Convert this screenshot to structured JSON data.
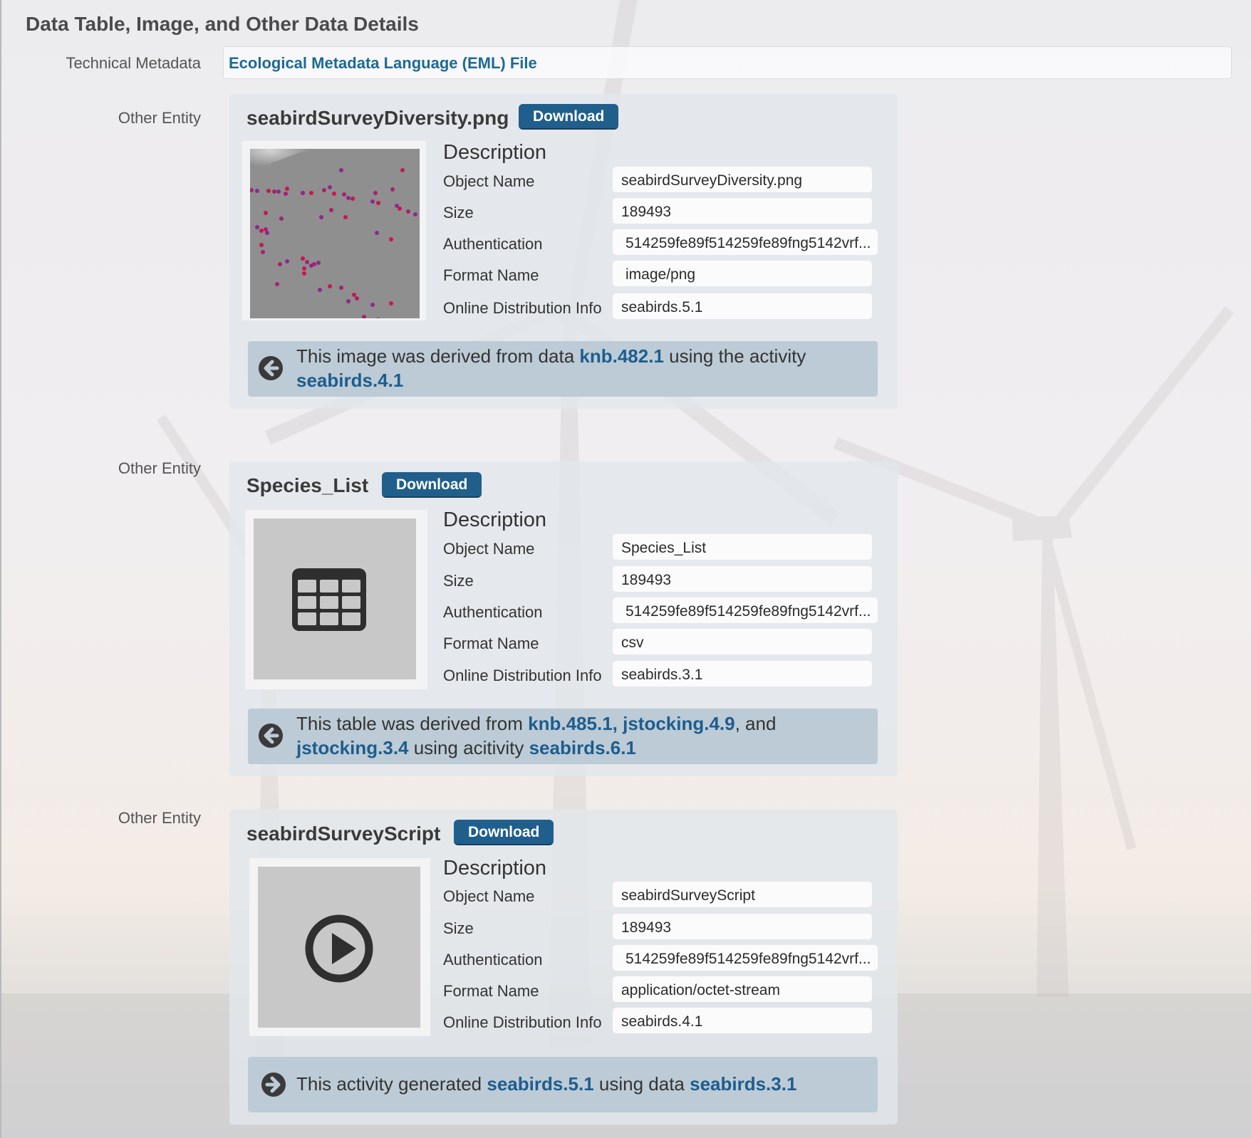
{
  "section_title": "Data Table, Image, and Other Data Details",
  "technical_metadata": {
    "label": "Technical Metadata",
    "link": "Ecological Metadata Language (EML) File"
  },
  "download_label": "Download",
  "entities": [
    {
      "label": "Other Entity",
      "title": "seabirdSurveyDiversity.png",
      "thumbnail": "scatter-plot-image",
      "description_label": "Description",
      "fields": {
        "object_name_label": "Object Name",
        "object_name": "seabirdSurveyDiversity.png",
        "size_label": "Size",
        "size": "189493",
        "auth_label": "Authentication",
        "auth": "514259fe89f514259fe89fng5142vrf...",
        "format_label": "Format Name",
        "format": "image/png",
        "dist_label": "Online Distribution Info",
        "dist": "seabirds.5.1"
      },
      "provenance": {
        "direction": "arrow-left-icon",
        "t1": "This image was derived from data ",
        "l1": "knb.482.1",
        "t2": " using the activity",
        "l2": "seabirds.4.1"
      }
    },
    {
      "label": "Other Entity",
      "title": "Species_List",
      "thumbnail": "table-icon",
      "description_label": "Description",
      "fields": {
        "object_name_label": "Object Name",
        "object_name": "Species_List",
        "size_label": "Size",
        "size": "189493",
        "auth_label": "Authentication",
        "auth": "514259fe89f514259fe89fng5142vrf...",
        "format_label": "Format Name",
        "format": "csv",
        "dist_label": "Online Distribution Info",
        "dist": "seabirds.3.1"
      },
      "provenance": {
        "direction": "arrow-left-icon",
        "t1": "This table was derived from ",
        "l1": "knb.485.1, jstocking.4.9",
        "t2": ", and",
        "l2": "jstocking.3.4",
        "t3": " using acitivity ",
        "l3": "seabirds.6.1"
      }
    },
    {
      "label": "Other Entity",
      "title": "seabirdSurveyScript",
      "thumbnail": "play-icon",
      "description_label": "Description",
      "fields": {
        "object_name_label": "Object Name",
        "object_name": "seabirdSurveyScript",
        "size_label": "Size",
        "size": "189493",
        "auth_label": "Authentication",
        "auth": "514259fe89f514259fe89fng5142vrf...",
        "format_label": "Format Name",
        "format": "application/octet-stream",
        "dist_label": "Online Distribution Info",
        "dist": "seabirds.4.1"
      },
      "provenance": {
        "direction": "arrow-right-icon",
        "t1": "This activity generated ",
        "l1": "seabirds.5.1",
        "t2": " using data ",
        "l2": "seabirds.3.1"
      }
    }
  ]
}
